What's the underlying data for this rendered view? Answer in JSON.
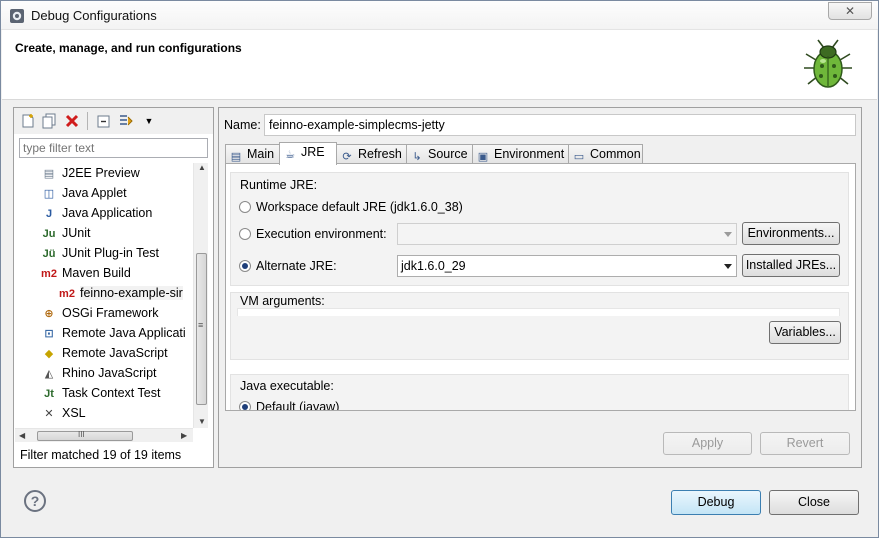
{
  "window": {
    "title": "Debug Configurations",
    "close_label": "✕"
  },
  "banner": {
    "text": "Create, manage, and run configurations"
  },
  "left": {
    "toolbar": [
      "new-config-icon",
      "duplicate-icon",
      "delete-icon",
      "collapse-all-icon",
      "filter-icon",
      "dropdown-icon"
    ],
    "filter_placeholder": "type filter text",
    "tree": [
      {
        "label": "J2EE Preview",
        "icon": "j2ee-icon",
        "indent": 0
      },
      {
        "label": "Java Applet",
        "icon": "applet-icon",
        "indent": 0
      },
      {
        "label": "Java Application",
        "icon": "java-app-icon",
        "indent": 0
      },
      {
        "label": "JUnit",
        "icon": "junit-icon",
        "indent": 0
      },
      {
        "label": "JUnit Plug-in Test",
        "icon": "junit-plugin-icon",
        "indent": 0
      },
      {
        "label": "Maven Build",
        "icon": "maven-icon",
        "indent": 0
      },
      {
        "label": "feinno-example-sir",
        "icon": "maven-icon",
        "indent": 1,
        "selected": true
      },
      {
        "label": "OSGi Framework",
        "icon": "osgi-icon",
        "indent": 0
      },
      {
        "label": "Remote Java Applicati",
        "icon": "remote-java-icon",
        "indent": 0
      },
      {
        "label": "Remote JavaScript",
        "icon": "remote-js-icon",
        "indent": 0
      },
      {
        "label": "Rhino JavaScript",
        "icon": "rhino-icon",
        "indent": 0
      },
      {
        "label": "Task Context Test",
        "icon": "task-test-icon",
        "indent": 0
      },
      {
        "label": "XSL",
        "icon": "xsl-icon",
        "indent": 0
      }
    ],
    "hscroll_label": "III",
    "vscroll_label": "≡",
    "filter_status": "Filter matched 19 of 19 items"
  },
  "right": {
    "name_label": "Name:",
    "name_value": "feinno-example-simplecms-jetty",
    "tabs": [
      {
        "label": "Main",
        "icon": "main-tab-icon",
        "active": false
      },
      {
        "label": "JRE",
        "icon": "jre-tab-icon",
        "active": true
      },
      {
        "label": "Refresh",
        "icon": "refresh-tab-icon",
        "active": false
      },
      {
        "label": "Source",
        "icon": "source-tab-icon",
        "active": false
      },
      {
        "label": "Environment",
        "icon": "environment-tab-icon",
        "active": false
      },
      {
        "label": "Common",
        "icon": "common-tab-icon",
        "active": false
      }
    ],
    "runtime_jre": {
      "title": "Runtime JRE:",
      "workspace_default": "Workspace default JRE (jdk1.6.0_38)",
      "execution_env": "Execution environment:",
      "execution_env_value": "",
      "environments_button": "Environments...",
      "alternate": "Alternate JRE:",
      "alternate_value": "jdk1.6.0_29",
      "installed_button": "Installed JREs...",
      "selected": "alternate"
    },
    "vm_args": {
      "title": "VM arguments:",
      "variables_button": "Variables..."
    },
    "java_exec": {
      "title": "Java executable:",
      "default_label": "Default (javaw)"
    },
    "apply_button": "Apply",
    "revert_button": "Revert"
  },
  "footer": {
    "help": "?",
    "debug_button": "Debug",
    "close_button": "Close"
  }
}
